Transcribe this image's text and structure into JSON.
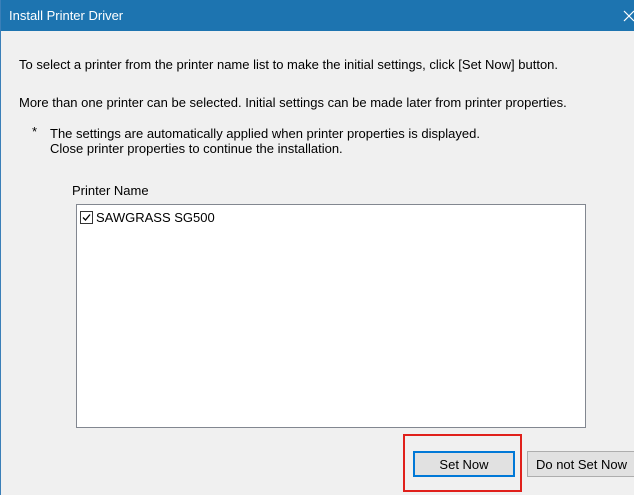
{
  "window": {
    "title": "Install Printer Driver",
    "close_glyph": "×"
  },
  "instructions": {
    "line1": "To select a printer from the printer name list to make the initial settings, click [Set Now] button.",
    "line2": "More than one printer can be selected. Initial settings can be made later from printer properties.",
    "note_marker": "*",
    "note_line1": "The settings are automatically applied when printer properties is displayed.",
    "note_line2": "Close printer properties to continue the installation."
  },
  "printer_list": {
    "label": "Printer Name",
    "items": [
      {
        "name": "SAWGRASS SG500",
        "checked": true
      }
    ]
  },
  "buttons": {
    "set_now": "Set Now",
    "do_not_set_now": "Do not Set Now"
  },
  "colors": {
    "titlebar": "#1d74b0",
    "highlight": "#e0201b",
    "focus_border": "#0078d7"
  }
}
